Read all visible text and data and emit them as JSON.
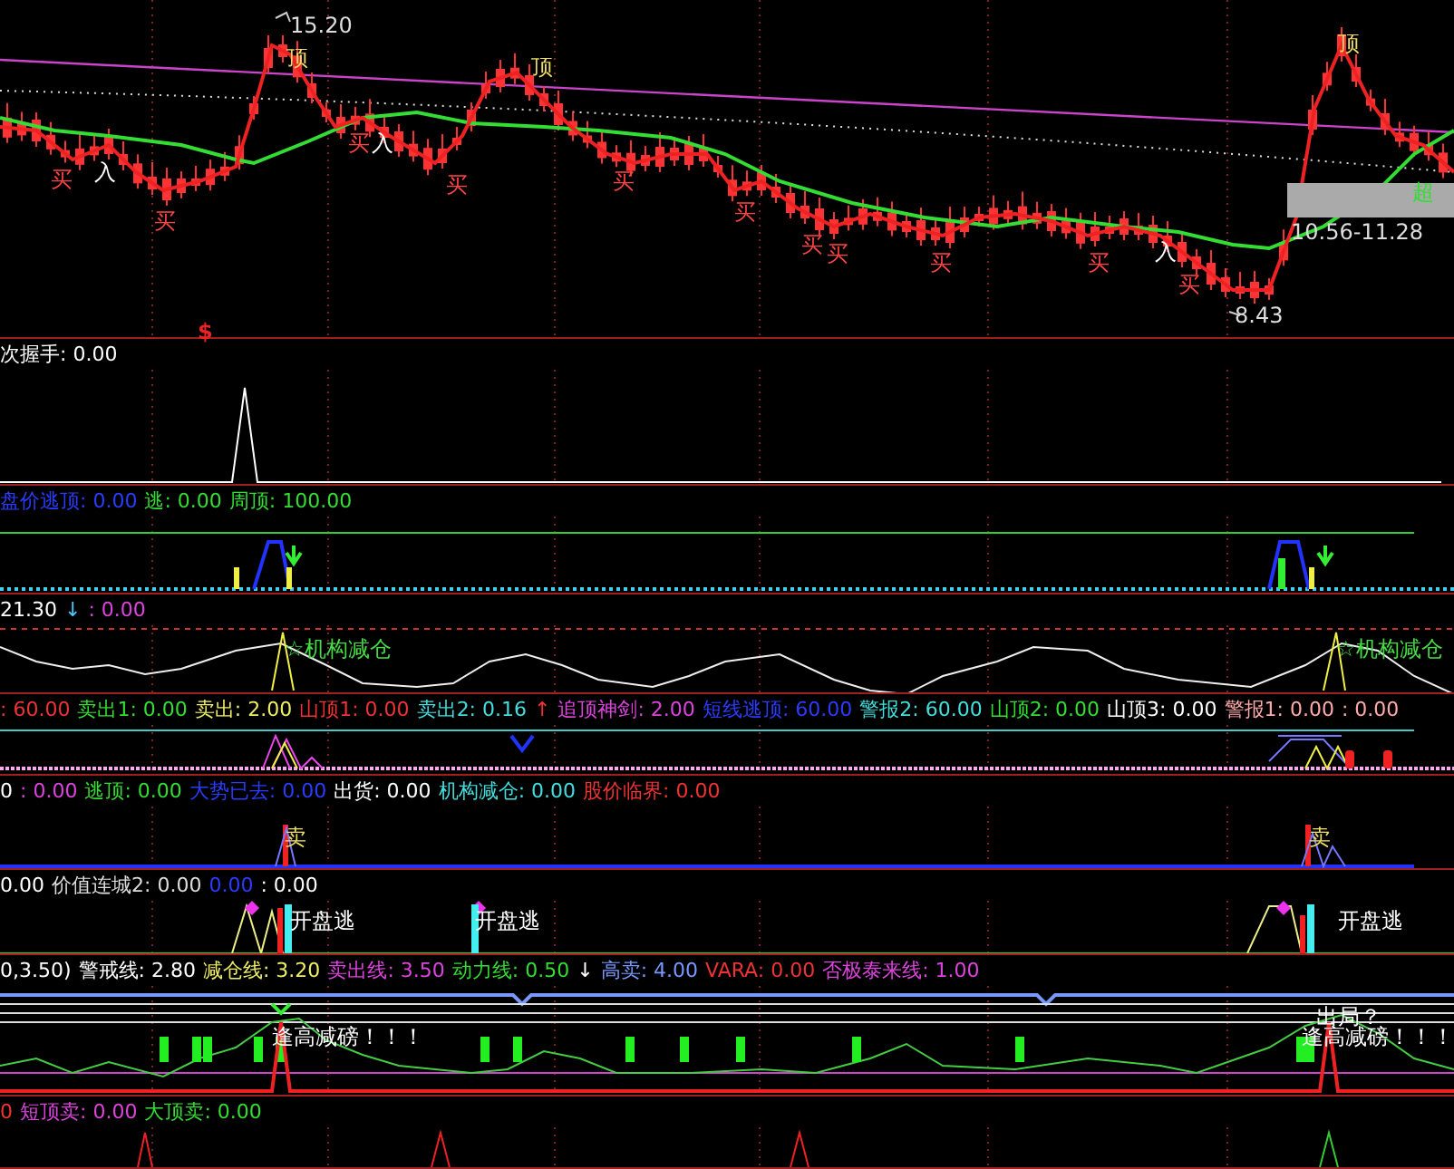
{
  "main_chart": {
    "labels": [
      {
        "kind": "peak",
        "text": "15.20"
      },
      {
        "kind": "top",
        "text": "顶"
      },
      {
        "kind": "top",
        "text": "顶"
      },
      {
        "kind": "top",
        "text": "顶"
      },
      {
        "kind": "buy",
        "text": "买"
      },
      {
        "kind": "buy",
        "text": "买"
      },
      {
        "kind": "buy",
        "text": "买"
      },
      {
        "kind": "entry",
        "text": "入"
      },
      {
        "kind": "buy",
        "text": "买"
      },
      {
        "kind": "buy",
        "text": "买"
      },
      {
        "kind": "buy",
        "text": "买"
      },
      {
        "kind": "buy",
        "text": "买"
      },
      {
        "kind": "buy",
        "text": "买"
      },
      {
        "kind": "buy",
        "text": "买"
      },
      {
        "kind": "buy",
        "text": "买"
      },
      {
        "kind": "entry",
        "text": "入"
      },
      {
        "kind": "entry",
        "text": "入"
      },
      {
        "kind": "buy",
        "text": "买"
      },
      {
        "kind": "dollar",
        "text": "$"
      },
      {
        "kind": "low",
        "text": "8.43"
      },
      {
        "kind": "range",
        "text": "10.56-11.28"
      },
      {
        "kind": "short",
        "text": "超"
      }
    ]
  },
  "panels": [
    {
      "legend": [
        {
          "text": "次握手: 0.00",
          "color": "#ffffff"
        }
      ]
    },
    {
      "legend": [
        {
          "text": "盘价逃顶: 0.00",
          "color": "#2a3cff"
        },
        {
          "text": "逃: 0.00",
          "color": "#33dd33"
        },
        {
          "text": "周顶: 100.00",
          "color": "#33dd33"
        }
      ]
    },
    {
      "legend": [
        {
          "text": "21.30",
          "color": "#ffffff"
        },
        {
          "text": "↓",
          "color": "#44ccff"
        },
        {
          "text": ": 0.00",
          "color": "#dd44dd"
        }
      ],
      "labels": [
        {
          "text": "☆机构减仓"
        },
        {
          "text": "☆机构减仓"
        }
      ]
    },
    {
      "legend": [
        {
          "text": ": 60.00",
          "color": "#ee3333"
        },
        {
          "text": "卖出1: 0.00",
          "color": "#33dd33"
        },
        {
          "text": "卖出: 2.00",
          "color": "#eeee66"
        },
        {
          "text": "山顶1: 0.00",
          "color": "#ee3333"
        },
        {
          "text": "卖出2: 0.16",
          "color": "#44dddd"
        },
        {
          "text": "↑",
          "color": "#ee3333"
        },
        {
          "text": "追顶神剑: 2.00",
          "color": "#dd44dd"
        },
        {
          "text": "短线逃顶: 60.00",
          "color": "#2a3cff"
        },
        {
          "text": "警报2: 60.00",
          "color": "#44dddd"
        },
        {
          "text": "山顶2: 0.00",
          "color": "#33dd33"
        },
        {
          "text": "山顶3: 0.00",
          "color": "#ffffff"
        },
        {
          "text": "警报1: 0.00",
          "color": "#ffaaaa"
        },
        {
          "text": ": 0.00",
          "color": "#ffaaaa"
        }
      ]
    },
    {
      "legend": [
        {
          "text": "0",
          "color": "#ffffff"
        },
        {
          "text": ": 0.00",
          "color": "#dd44dd"
        },
        {
          "text": "逃顶: 0.00",
          "color": "#33dd33"
        },
        {
          "text": "大势已去: 0.00",
          "color": "#2a3cff"
        },
        {
          "text": "出货: 0.00",
          "color": "#ffffff"
        },
        {
          "text": "机构减仓: 0.00",
          "color": "#44dddd"
        },
        {
          "text": "股价临界: 0.00",
          "color": "#ee3333"
        }
      ],
      "labels": [
        {
          "text": "卖"
        },
        {
          "text": "卖"
        }
      ]
    },
    {
      "legend": [
        {
          "text": "0.00",
          "color": "#ffffff"
        },
        {
          "text": "价值连城2: 0.00",
          "color": "#dddddd"
        },
        {
          "text": "0.00",
          "color": "#2a3cff"
        },
        {
          "text": ": 0.00",
          "color": "#ffffff"
        }
      ],
      "labels": [
        {
          "text": "开盘逃"
        },
        {
          "text": "开盘逃"
        },
        {
          "text": "开盘逃"
        }
      ]
    },
    {
      "legend": [
        {
          "text": "0,3.50)",
          "color": "#ffffff"
        },
        {
          "text": "警戒线: 2.80",
          "color": "#ffffff"
        },
        {
          "text": "减仓线: 3.20",
          "color": "#eeee66"
        },
        {
          "text": "卖出线: 3.50",
          "color": "#dd44dd"
        },
        {
          "text": "动力线: 0.50",
          "color": "#33dd33"
        },
        {
          "text": "↓",
          "color": "#ffffff"
        },
        {
          "text": "高卖: 4.00",
          "color": "#7799ff"
        },
        {
          "text": "VARA: 0.00",
          "color": "#ee3333"
        },
        {
          "text": "否极泰来线: 1.00",
          "color": "#dd44dd"
        }
      ],
      "labels": [
        {
          "text": "逢高减磅！！！"
        },
        {
          "text": "出局？"
        },
        {
          "text": "逢高减磅！！！"
        }
      ]
    },
    {
      "legend": [
        {
          "text": "0",
          "color": "#ee3333"
        },
        {
          "text": "短顶卖: 0.00",
          "color": "#dd44dd"
        },
        {
          "text": "大顶卖: 0.00",
          "color": "#33dd33"
        }
      ]
    }
  ]
}
